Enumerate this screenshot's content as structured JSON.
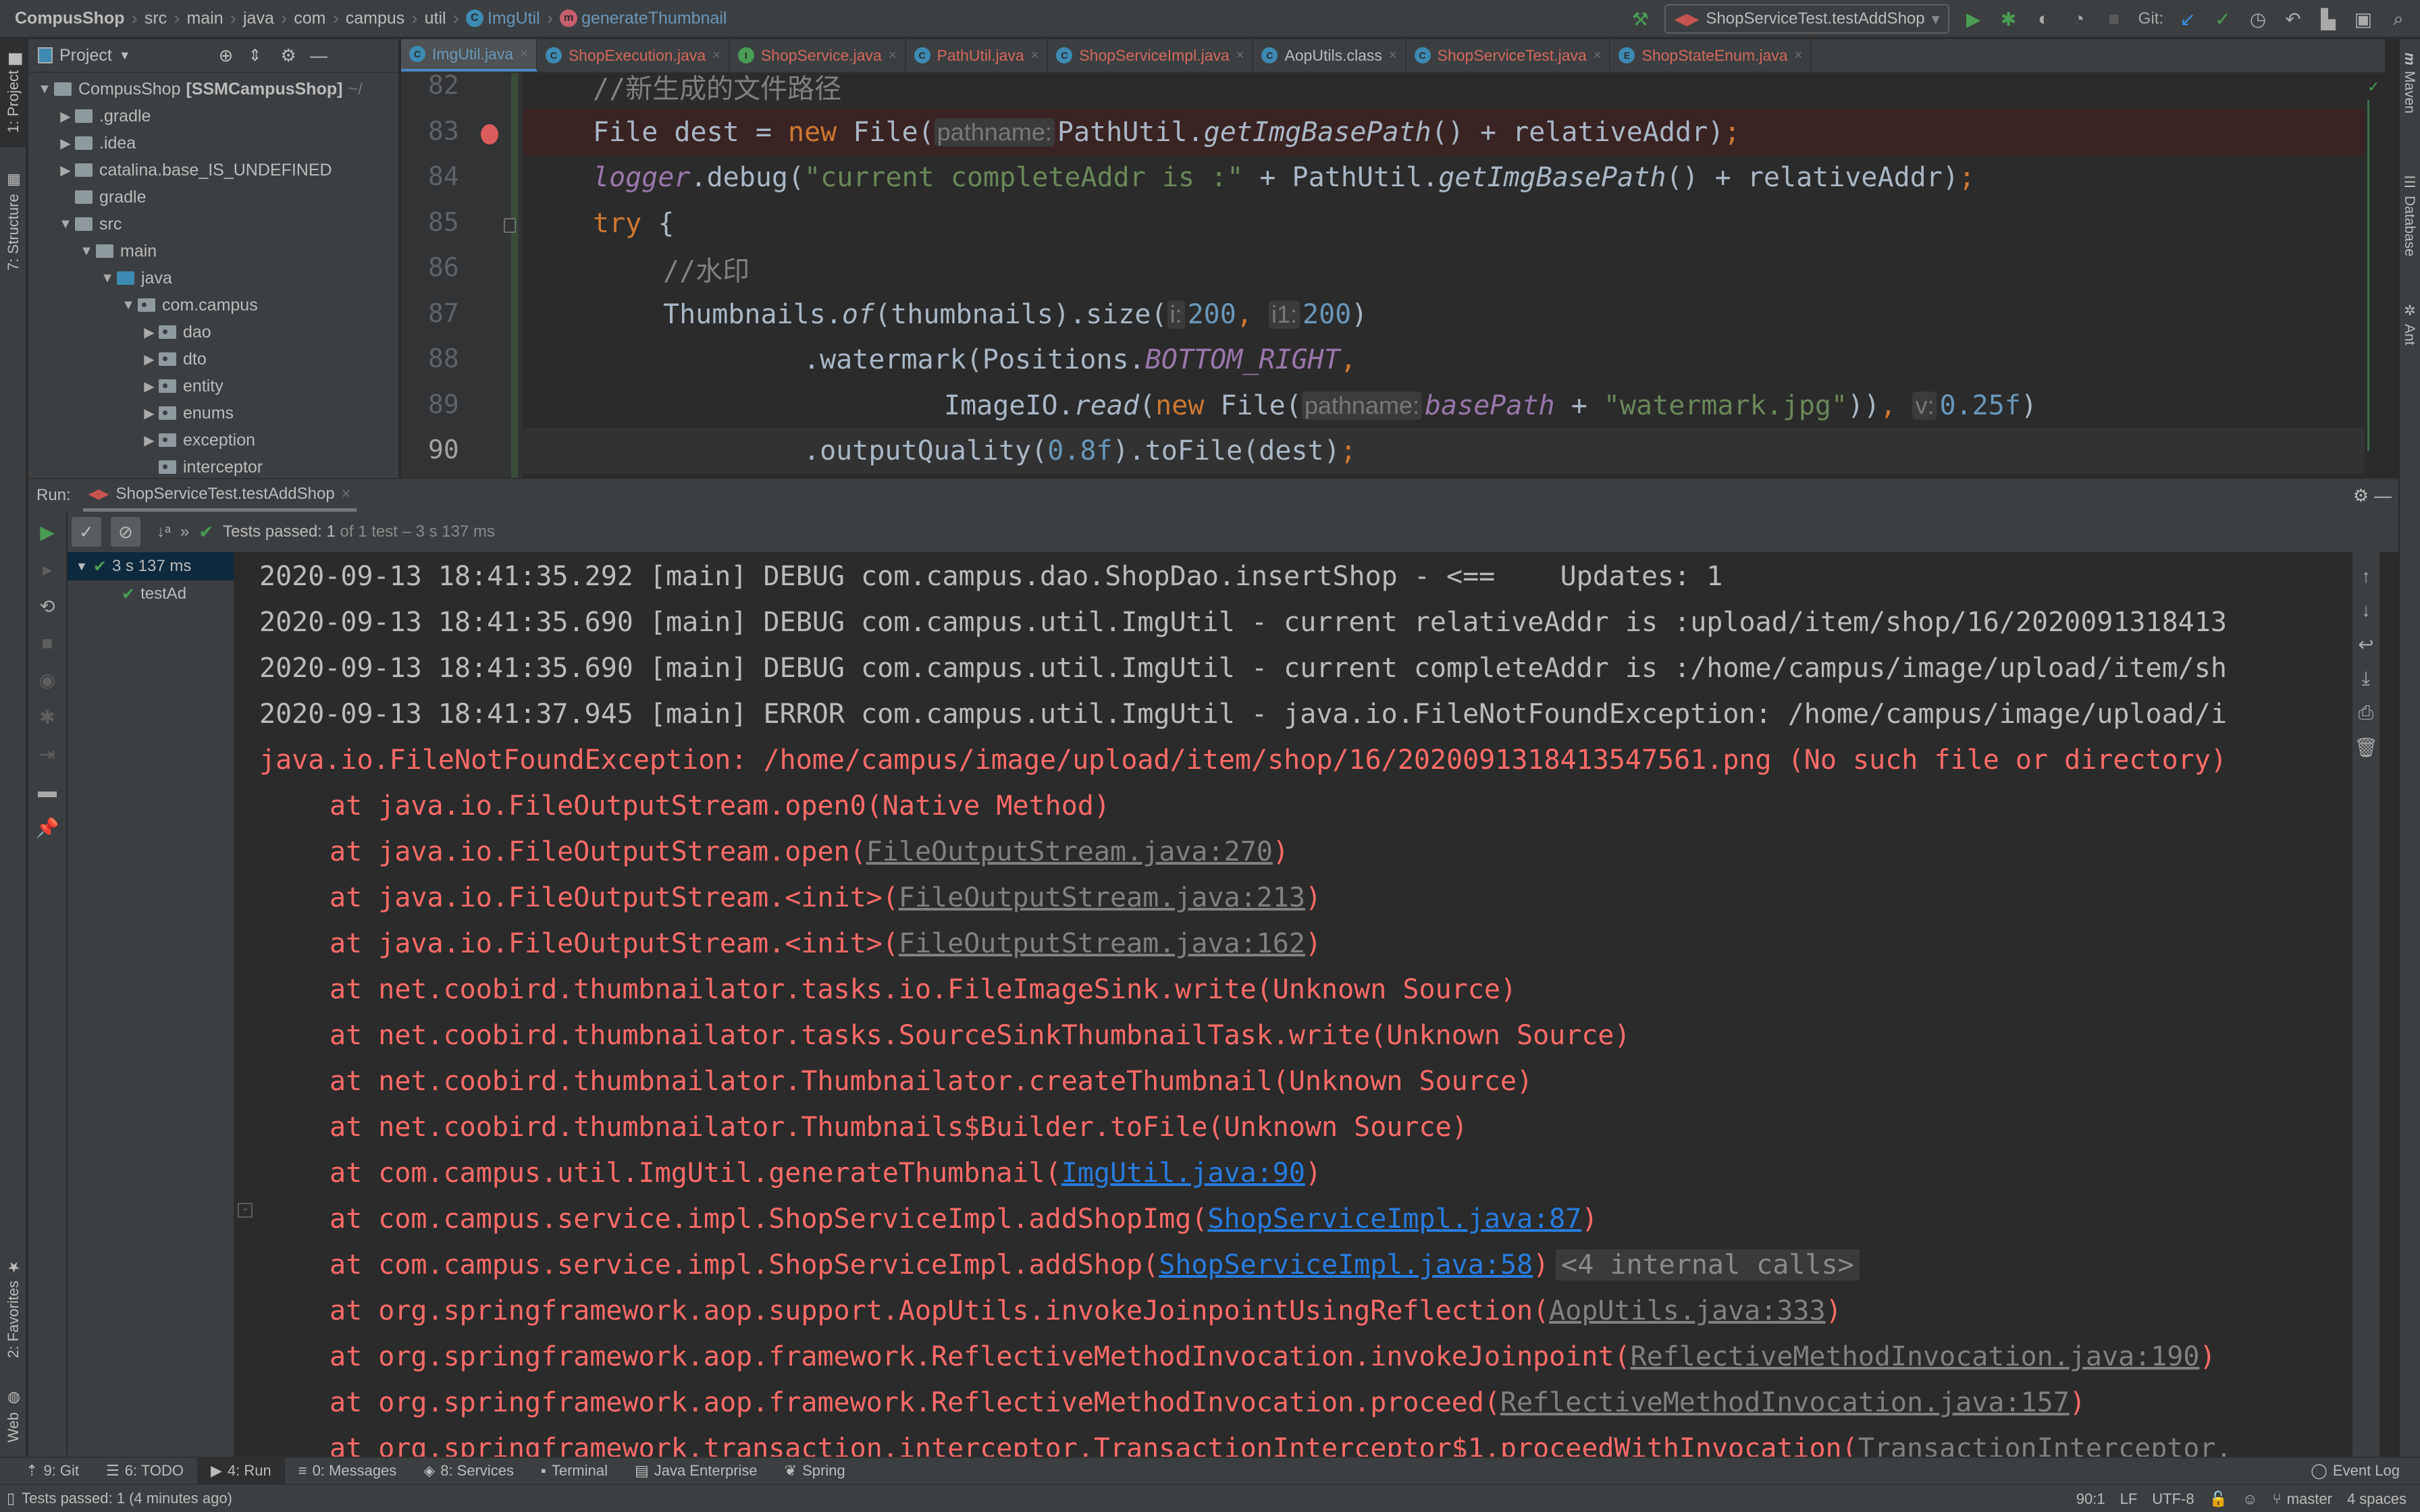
{
  "navbar": {
    "breadcrumbs": [
      "CompusShop",
      "src",
      "main",
      "java",
      "com",
      "campus",
      "util",
      "ImgUtil",
      "generateThumbnail"
    ],
    "run_config": "ShopServiceTest.testAddShop",
    "git_label": "Git:"
  },
  "left_strip": {
    "tabs": [
      "1: Project",
      "7: Structure",
      "2: Favorites",
      "Web"
    ]
  },
  "right_strip": {
    "tabs": [
      "Maven",
      "Database",
      "Ant"
    ]
  },
  "project_panel": {
    "title": "Project",
    "tree": [
      {
        "label": "CompusShop",
        "suffix": "[SSMCampusShop]",
        "extra": "~/",
        "depth": 0,
        "expanded": true,
        "type": "module"
      },
      {
        "label": ".gradle",
        "depth": 1,
        "expanded": false,
        "type": "folder"
      },
      {
        "label": ".idea",
        "depth": 1,
        "expanded": false,
        "type": "folder"
      },
      {
        "label": "catalina.base_IS_UNDEFINED",
        "depth": 1,
        "expanded": false,
        "type": "folder"
      },
      {
        "label": "gradle",
        "depth": 1,
        "expanded": null,
        "type": "folder"
      },
      {
        "label": "src",
        "depth": 1,
        "expanded": true,
        "type": "folder"
      },
      {
        "label": "main",
        "depth": 2,
        "expanded": true,
        "type": "folder"
      },
      {
        "label": "java",
        "depth": 3,
        "expanded": true,
        "type": "source"
      },
      {
        "label": "com.campus",
        "depth": 4,
        "expanded": true,
        "type": "package"
      },
      {
        "label": "dao",
        "depth": 5,
        "expanded": false,
        "type": "package"
      },
      {
        "label": "dto",
        "depth": 5,
        "expanded": false,
        "type": "package"
      },
      {
        "label": "entity",
        "depth": 5,
        "expanded": false,
        "type": "package"
      },
      {
        "label": "enums",
        "depth": 5,
        "expanded": false,
        "type": "package"
      },
      {
        "label": "exception",
        "depth": 5,
        "expanded": false,
        "type": "package"
      },
      {
        "label": "interceptor",
        "depth": 5,
        "expanded": null,
        "type": "package"
      }
    ]
  },
  "editor_tabs": [
    {
      "label": "ImgUtil.java",
      "icon": "C",
      "active": true
    },
    {
      "label": "ShopExecution.java",
      "icon": "C",
      "active": false
    },
    {
      "label": "ShopService.java",
      "icon": "I",
      "active": false
    },
    {
      "label": "PathUtil.java",
      "icon": "C",
      "active": false
    },
    {
      "label": "ShopServiceImpl.java",
      "icon": "C",
      "active": false
    },
    {
      "label": "AopUtils.class",
      "icon": "C",
      "active": false
    },
    {
      "label": "ShopServiceTest.java",
      "icon": "C",
      "active": false
    },
    {
      "label": "ShopStateEnum.java",
      "icon": "E",
      "active": false
    }
  ],
  "editor": {
    "lines": [
      {
        "num": "82",
        "text": "//新生成的文件路径"
      },
      {
        "num": "83",
        "text": "File dest = new File( pathname: PathUtil.getImgBasePath() + relativeAddr);",
        "breakpoint": true
      },
      {
        "num": "84",
        "text": "logger.debug(\"current completeAddr is :\" + PathUtil.getImgBasePath() + relativeAddr);"
      },
      {
        "num": "85",
        "text": "try {"
      },
      {
        "num": "86",
        "text": "//水印"
      },
      {
        "num": "87",
        "text": "Thumbnails.of(thumbnails).size( i: 200, i1: 200)"
      },
      {
        "num": "88",
        "text": ".watermark(Positions.BOTTOM_RIGHT,"
      },
      {
        "num": "89",
        "text": "ImageIO.read(new File( pathname: basePath + \"watermark.jpg\")), v: 0.25f)"
      },
      {
        "num": "90",
        "text": ".outputQuality(0.8f).toFile(dest);",
        "current": true
      }
    ],
    "tokens": {
      "l82": "//新生成的文件路径",
      "l83_a": "File dest = ",
      "l83_new": "new",
      "l83_b": " File(",
      "l83_hint": "pathname:",
      "l83_c": "PathUtil.",
      "l83_m": "getImgBasePath",
      "l83_d": "() + relativeAddr)",
      "l83_semi": ";",
      "l84_logger": "logger",
      "l84_a": ".debug(",
      "l84_str": "\"current completeAddr is :\"",
      "l84_b": " + PathUtil.",
      "l84_m": "getImgBasePath",
      "l84_c": "() + relativeAddr)",
      "l84_semi": ";",
      "l85_try": "try",
      "l85_b": " {",
      "l86": "//水印",
      "l87_a": "Thumbnails.",
      "l87_of": "of",
      "l87_b": "(thumbnails).size(",
      "l87_h1": "i:",
      "l87_n1": "200",
      "l87_comma": ", ",
      "l87_h2": "i1:",
      "l87_n2": "200",
      "l87_c": ")",
      "l88_a": ".watermark(Positions.",
      "l88_const": "BOTTOM_RIGHT",
      "l88_comma": ",",
      "l89_a": "ImageIO.",
      "l89_read": "read",
      "l89_b": "(",
      "l89_new": "new",
      "l89_c": " File(",
      "l89_hint": "pathname:",
      "l89_var": "basePath",
      "l89_d": " + ",
      "l89_str": "\"watermark.jpg\"",
      "l89_e": "))",
      "l89_comma": ", ",
      "l89_hint2": "v:",
      "l89_num": "0.25f",
      "l89_f": ")",
      "l90_a": ".outputQuality(",
      "l90_num": "0.8f",
      "l90_b": ").toFile(dest)",
      "l90_semi": ";"
    }
  },
  "run_panel": {
    "label": "Run:",
    "tab": "ShopServiceTest.testAddShop",
    "test_status_bold": "Tests passed: 1",
    "test_status_rest": " of 1 test – 3 s 137 ms",
    "tree_root": "3 s 137 ms",
    "tree_child": "testAd",
    "console": {
      "log": [
        {
          "text": "2020-09-13 18:41:35.292 [main] DEBUG com.campus.dao.ShopDao.insertShop - <==    Updates: 1"
        },
        {
          "text": "2020-09-13 18:41:35.690 [main] DEBUG com.campus.util.ImgUtil - current relativeAddr is :upload/item/shop/16/2020091318413"
        },
        {
          "text": "2020-09-13 18:41:35.690 [main] DEBUG com.campus.util.ImgUtil - current completeAddr is :/home/campus/image/upload/item/sh"
        },
        {
          "text": "2020-09-13 18:41:37.945 [main] ERROR com.campus.util.ImgUtil - java.io.FileNotFoundException: /home/campus/image/upload/i"
        }
      ],
      "exception": "java.io.FileNotFoundException: /home/campus/image/upload/item/shop/16/2020091318413547561.png (No such file or directory)",
      "stack": [
        {
          "prefix": "at java.io.FileOutputStream.open0(Native Method)",
          "link": null,
          "suffix": ""
        },
        {
          "prefix": "at java.io.FileOutputStream.open(",
          "link": "FileOutputStream.java:270",
          "link_type": "gray",
          "suffix": ")"
        },
        {
          "prefix": "at java.io.FileOutputStream.<init>(",
          "link": "FileOutputStream.java:213",
          "link_type": "gray",
          "suffix": ")"
        },
        {
          "prefix": "at java.io.FileOutputStream.<init>(",
          "link": "FileOutputStream.java:162",
          "link_type": "gray",
          "suffix": ")"
        },
        {
          "prefix": "at net.coobird.thumbnailator.tasks.io.FileImageSink.write(Unknown Source)",
          "link": null,
          "suffix": ""
        },
        {
          "prefix": "at net.coobird.thumbnailator.tasks.SourceSinkThumbnailTask.write(Unknown Source)",
          "link": null,
          "suffix": ""
        },
        {
          "prefix": "at net.coobird.thumbnailator.Thumbnailator.createThumbnail(Unknown Source)",
          "link": null,
          "suffix": ""
        },
        {
          "prefix": "at net.coobird.thumbnailator.Thumbnails$Builder.toFile(Unknown Source)",
          "link": null,
          "suffix": ""
        },
        {
          "prefix": "at com.campus.util.ImgUtil.generateThumbnail(",
          "link": "ImgUtil.java:90",
          "link_type": "blue",
          "suffix": ")"
        },
        {
          "prefix": "at com.campus.service.impl.ShopServiceImpl.addShopImg(",
          "link": "ShopServiceImpl.java:87",
          "link_type": "blue",
          "suffix": ")"
        },
        {
          "prefix": "at com.campus.service.impl.ShopServiceImpl.addShop(",
          "link": "ShopServiceImpl.java:58",
          "link_type": "blue",
          "suffix": ")",
          "fold": "<4 internal calls>"
        },
        {
          "prefix": "at org.springframework.aop.support.AopUtils.invokeJoinpointUsingReflection(",
          "link": "AopUtils.java:333",
          "link_type": "gray",
          "suffix": ")"
        },
        {
          "prefix": "at org.springframework.aop.framework.ReflectiveMethodInvocation.invokeJoinpoint(",
          "link": "ReflectiveMethodInvocation.java:190",
          "link_type": "gray",
          "suffix": ")"
        },
        {
          "prefix": "at org.springframework.aop.framework.ReflectiveMethodInvocation.proceed(",
          "link": "ReflectiveMethodInvocation.java:157",
          "link_type": "gray",
          "suffix": ")"
        },
        {
          "prefix": "at org.springframework.transaction.interceptor.TransactionInterceptor$1.proceedWithInvocation(",
          "link": "TransactionInterceptor.",
          "link_type": "gray",
          "suffix": ""
        }
      ]
    }
  },
  "bottom_tabs": [
    {
      "label": "9: Git",
      "icon": "git-icon"
    },
    {
      "label": "6: TODO",
      "icon": "todo-icon"
    },
    {
      "label": "4: Run",
      "icon": "run-icon",
      "active": true
    },
    {
      "label": "0: Messages",
      "icon": "messages-icon"
    },
    {
      "label": "8: Services",
      "icon": "services-icon"
    },
    {
      "label": "Terminal",
      "icon": "terminal-icon"
    },
    {
      "label": "Java Enterprise",
      "icon": "java-enterprise-icon"
    },
    {
      "label": "Spring",
      "icon": "spring-icon"
    }
  ],
  "event_log": "Event Log",
  "status_bar": {
    "message": "Tests passed: 1 (4 minutes ago)",
    "position": "90:1",
    "line_sep": "LF",
    "encoding": "UTF-8",
    "branch": "master",
    "indent": "4 spaces"
  },
  "colors": {
    "error_red": "#ff6b68",
    "link_blue": "#287bde",
    "pass_green": "#499c54",
    "keyword": "#cc7832",
    "string": "#6a8759",
    "number": "#6897bb"
  }
}
